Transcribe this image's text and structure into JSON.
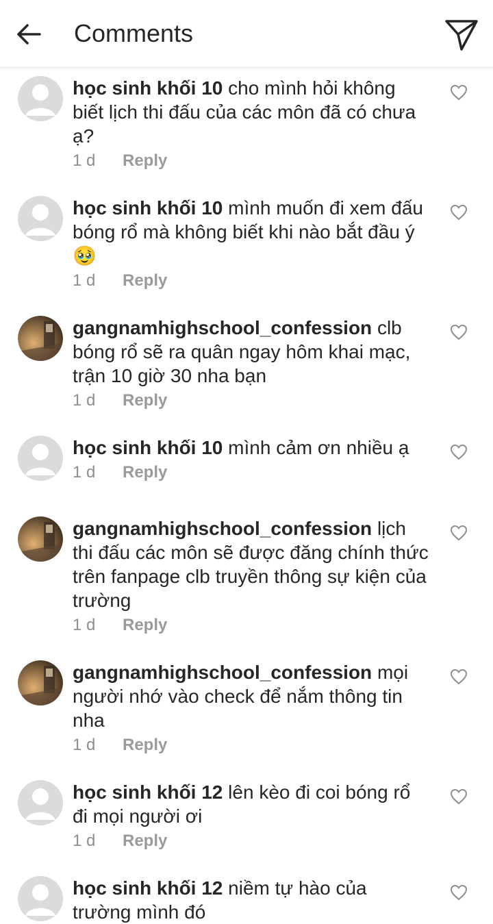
{
  "header": {
    "title": "Comments"
  },
  "comments": [
    {
      "username": "học sinh khối 10",
      "text": "cho mình hỏi không biết lịch thi đấu của các môn đã có chưa ạ?",
      "time": "1 d",
      "reply_label": "Reply",
      "avatar": "default"
    },
    {
      "username": "học sinh khối 10",
      "text": "mình muốn đi xem đấu bóng rổ mà không biết khi nào bắt đầu ý 🥹",
      "time": "1 d",
      "reply_label": "Reply",
      "avatar": "default"
    },
    {
      "username": "gangnamhighschool_confession",
      "text": "clb bóng rổ sẽ ra quân ngay hôm khai mạc, trận 10 giờ 30 nha bạn",
      "time": "1 d",
      "reply_label": "Reply",
      "avatar": "photo"
    },
    {
      "username": "học sinh khối 10",
      "text": "mình cảm ơn nhiều ạ",
      "time": "1 d",
      "reply_label": "Reply",
      "avatar": "default"
    },
    {
      "username": "gangnamhighschool_confession",
      "text": "lịch thi đấu các môn sẽ được đăng chính thức trên fanpage clb truyền thông sự kiện của trường",
      "time": "1 d",
      "reply_label": "Reply",
      "avatar": "photo"
    },
    {
      "username": "gangnamhighschool_confession",
      "text": "mọi người nhớ vào check để nắm thông tin nha",
      "time": "1 d",
      "reply_label": "Reply",
      "avatar": "photo"
    },
    {
      "username": "học sinh khối 12",
      "text": "lên kèo đi coi bóng rổ đi mọi người ơi",
      "time": "1 d",
      "reply_label": "Reply",
      "avatar": "default"
    },
    {
      "username": "học sinh khối 12",
      "text": "niềm tự hào của trường mình đó",
      "time": "",
      "reply_label": "",
      "avatar": "default"
    }
  ],
  "icons": {
    "back": "arrow-left-icon",
    "send": "paper-plane-icon",
    "like": "heart-outline-icon"
  },
  "colors": {
    "text": "#262626",
    "meta": "#8e8e8e",
    "avatar_placeholder": "#dbdbdb"
  }
}
